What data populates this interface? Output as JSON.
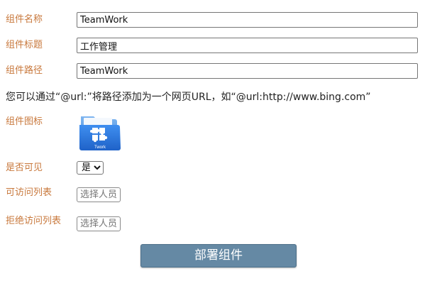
{
  "form": {
    "name_label": "组件名称",
    "name_value": "TeamWork",
    "title_label": "组件标题",
    "title_value": "工作管理",
    "path_label": "组件路径",
    "path_value": "TeamWork",
    "hint_text": "您可以通过“@url:”将路径添加为一个网页URL，如“@url:http://www.bing.com”",
    "icon_label": "组件图标",
    "icon_name": "teamwork-puzzle-folder-icon",
    "icon_caption": "Twork",
    "visible_label": "是否可见",
    "visible_options": [
      "是"
    ],
    "visible_selected": "是",
    "allow_label": "可访问列表",
    "allow_placeholder": "选择人员",
    "deny_label": "拒绝访问列表",
    "deny_placeholder": "选择人员",
    "deploy_label": "部署组件"
  },
  "colors": {
    "label": "#c8783c",
    "deploy_button": "#6589a4",
    "icon_blue": "#2f7fe0"
  }
}
